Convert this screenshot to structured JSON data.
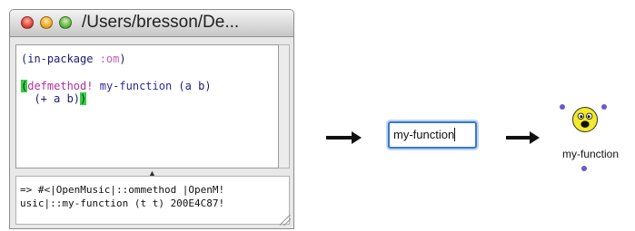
{
  "window": {
    "title": "/Users/bresson/De...",
    "editor_lines": {
      "line1_open": "(in-package ",
      "line1_kw": ":om",
      "line1_close": ")",
      "line2_hl_open": "(",
      "line2_defmethod": "defmethod!",
      "line2_space": " ",
      "line2_name": "my-function",
      "line2_args": " (a b)",
      "line3_body": "  (+ a b)",
      "line3_hl_close": ")"
    },
    "listener_lines": [
      "=> #<|OpenMusic|::ommethod |OpenM!",
      "usic|::my-function (t t) 200E4C87!"
    ]
  },
  "name_box": {
    "value": "my-function"
  },
  "function_box": {
    "label": "my-function"
  }
}
